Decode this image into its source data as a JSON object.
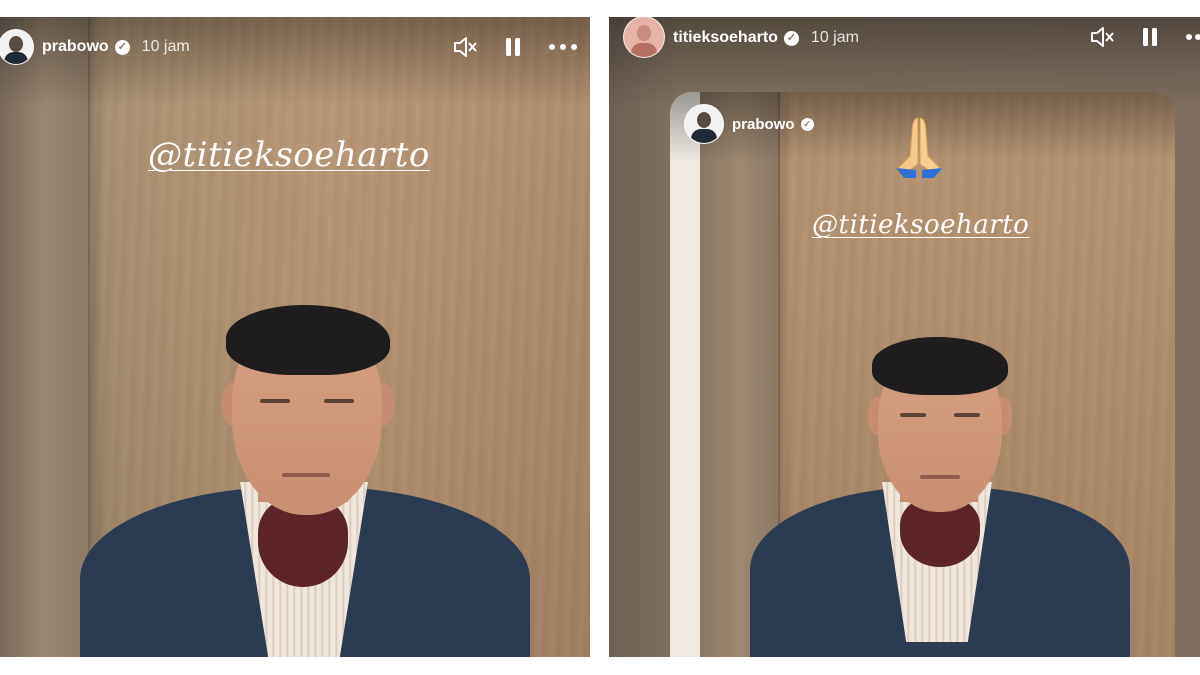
{
  "left_story": {
    "username": "prabowo",
    "time": "10 jam",
    "mention": "@titieksoeharto",
    "icons": {
      "mute": "speaker-muted-icon",
      "pause": "pause-icon",
      "more": "more-options-icon",
      "verified": "verified-badge-icon"
    }
  },
  "right_story": {
    "username": "titieksoeharto",
    "time": "10 jam",
    "icons": {
      "mute": "speaker-muted-icon",
      "pause": "pause-icon",
      "more": "more-options-icon",
      "verified": "verified-badge-icon"
    },
    "shared_post": {
      "username": "prabowo",
      "emoji": "🙏",
      "mention": "@titieksoeharto"
    }
  },
  "colors": {
    "text": "#ffffff",
    "wood": "#b38f6c",
    "jacket": "#2b3b52"
  }
}
